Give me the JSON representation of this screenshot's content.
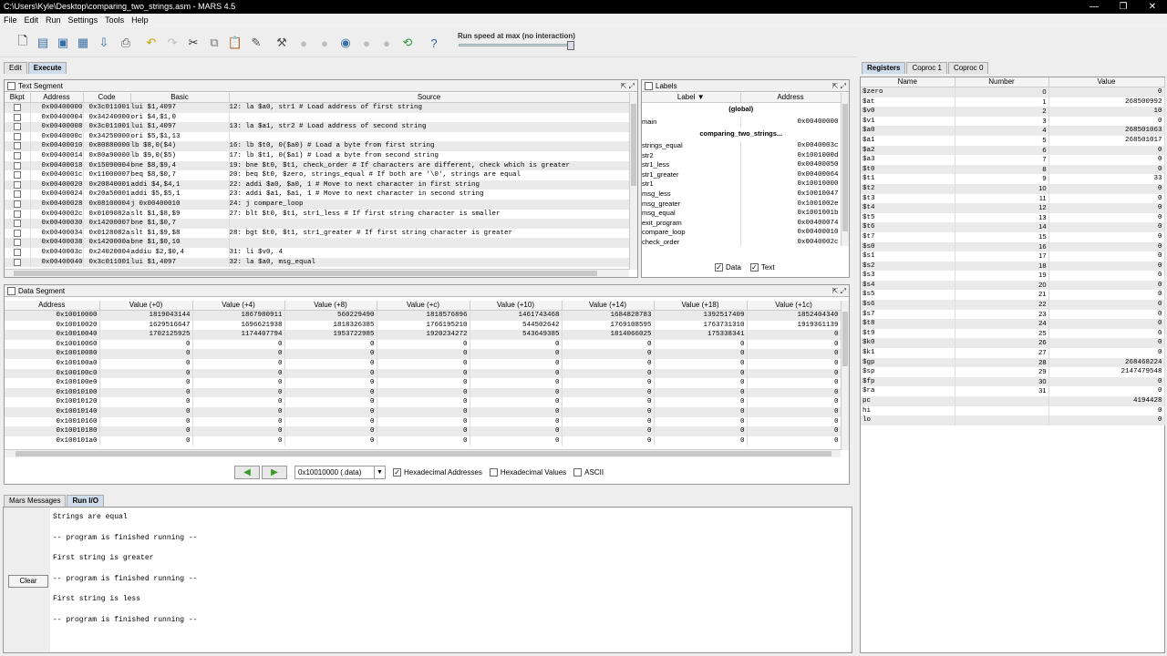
{
  "window": {
    "title": "C:\\Users\\Kyle\\Desktop\\comparing_two_strings.asm - MARS 4.5",
    "controls": [
      "—",
      "❐",
      "✕"
    ]
  },
  "menu": [
    "File",
    "Edit",
    "Run",
    "Settings",
    "Tools",
    "Help"
  ],
  "toolbar": {
    "speed_label": "Run speed at max (no interaction)",
    "speed_level": 1.0,
    "icons": [
      "new-icon",
      "open-icon",
      "save-icon",
      "save-as-icon",
      "dump-icon",
      "print-icon",
      "undo-icon",
      "redo-icon",
      "cut-icon",
      "copy-icon",
      "paste-icon",
      "find-replace-icon",
      "assemble-icon",
      "go-icon",
      "step-icon",
      "backstep-icon",
      "pause-icon",
      "stop-icon",
      "reset-icon",
      "help-icon"
    ]
  },
  "tabs": {
    "edit": "Edit",
    "execute": "Execute"
  },
  "text_segment": {
    "title": "Text Segment",
    "columns": [
      "Bkpt",
      "Address",
      "Code",
      "Basic",
      "Source"
    ],
    "rows": [
      [
        "0x00400000",
        "0x3c011001",
        "lui $1,4097",
        "12:      la $a0, str1    # Load address of first string"
      ],
      [
        "0x00400004",
        "0x34240000",
        "ori $4,$1,0",
        ""
      ],
      [
        "0x00400008",
        "0x3c011001",
        "lui $1,4097",
        "13:      la $a1, str2    # Load address of second string"
      ],
      [
        "0x0040000c",
        "0x34250000",
        "ori $5,$1,13",
        ""
      ],
      [
        "0x00400010",
        "0x80880000",
        "lb $8,0($4)",
        "16:      lb $t0, 0($a0)  # Load a byte from first string"
      ],
      [
        "0x00400014",
        "0x80a90000",
        "lb $9,0($5)",
        "17:      lb $t1, 0($a1)  # Load a byte from second string"
      ],
      [
        "0x00400018",
        "0x15090004",
        "bne $8,$9,4",
        "19:      bne $t0, $t1, check_order  # If characters are different, check which is greater"
      ],
      [
        "0x0040001c",
        "0x11000007",
        "beq $8,$0,7",
        "20:      beq $t0, $zero, strings_equal  # If both are '\\0', strings are equal"
      ],
      [
        "0x00400020",
        "0x20840001",
        "addi $4,$4,1",
        "22:      addi $a0, $a0, 1  # Move to next character in first string"
      ],
      [
        "0x00400024",
        "0x20a50001",
        "addi $5,$5,1",
        "23:      addi $a1, $a1, 1  # Move to next character in second string"
      ],
      [
        "0x00400028",
        "0x08100004",
        "j 0x00400010",
        "24:      j compare_loop"
      ],
      [
        "0x0040002c",
        "0x0109082a",
        "slt $1,$8,$9",
        "27:      blt $t0, $t1, str1_less  # If first string character is smaller"
      ],
      [
        "0x00400030",
        "0x14200007",
        "bne $1,$0,7",
        ""
      ],
      [
        "0x00400034",
        "0x0128082a",
        "slt $1,$9,$8",
        "28:      bgt $t0, $t1, str1_greater # If first string character is greater"
      ],
      [
        "0x00400038",
        "0x1420000a",
        "bne $1,$0,10",
        ""
      ],
      [
        "0x0040003c",
        "0x24020004",
        "addiu $2,$0,4",
        "31:      li $v0, 4"
      ],
      [
        "0x00400040",
        "0x3c011001",
        "lui $1,4097",
        "32:      la $a0, msg_equal"
      ]
    ]
  },
  "labels": {
    "title": "Labels",
    "columns": [
      "Label ▼",
      "Address"
    ],
    "groups": [
      {
        "name": "(global)",
        "items": [
          [
            "main",
            "0x00400000"
          ]
        ]
      },
      {
        "name": "comparing_two_strings...",
        "items": [
          [
            "strings_equal",
            "0x0040003c"
          ],
          [
            "str2",
            "0x1001000d"
          ],
          [
            "str1_less",
            "0x00400050"
          ],
          [
            "str1_greater",
            "0x00400064"
          ],
          [
            "str1",
            "0x10010000"
          ],
          [
            "msg_less",
            "0x10010047"
          ],
          [
            "msg_greater",
            "0x1001002e"
          ],
          [
            "msg_equal",
            "0x1001001b"
          ],
          [
            "exit_program",
            "0x00400074"
          ],
          [
            "compare_loop",
            "0x00400010"
          ],
          [
            "check_order",
            "0x0040002c"
          ]
        ]
      }
    ],
    "data_check": "Data",
    "text_check": "Text"
  },
  "data_segment": {
    "title": "Data Segment",
    "columns": [
      "Address",
      "Value (+0)",
      "Value (+4)",
      "Value (+8)",
      "Value (+c)",
      "Value (+10)",
      "Value (+14)",
      "Value (+18)",
      "Value (+1c)"
    ],
    "rows": [
      [
        "0x10010000",
        "1819043144",
        "1867980911",
        "560229490",
        "1818576896",
        "1461743468",
        "1684828783",
        "1392517409",
        "1852404340"
      ],
      [
        "0x10010020",
        "1629516647",
        "1696621938",
        "1818326385",
        "1766195210",
        "544502642",
        "1769108595",
        "1763731310",
        "1919361139"
      ],
      [
        "0x10010040",
        "1702125925",
        "1174407794",
        "1953722985",
        "1920234272",
        "543649385",
        "1814066025",
        "175338341",
        "0"
      ],
      [
        "0x10010060",
        "0",
        "0",
        "0",
        "0",
        "0",
        "0",
        "0",
        "0"
      ],
      [
        "0x10010080",
        "0",
        "0",
        "0",
        "0",
        "0",
        "0",
        "0",
        "0"
      ],
      [
        "0x100100a0",
        "0",
        "0",
        "0",
        "0",
        "0",
        "0",
        "0",
        "0"
      ],
      [
        "0x100100c0",
        "0",
        "0",
        "0",
        "0",
        "0",
        "0",
        "0",
        "0"
      ],
      [
        "0x100100e0",
        "0",
        "0",
        "0",
        "0",
        "0",
        "0",
        "0",
        "0"
      ],
      [
        "0x10010100",
        "0",
        "0",
        "0",
        "0",
        "0",
        "0",
        "0",
        "0"
      ],
      [
        "0x10010120",
        "0",
        "0",
        "0",
        "0",
        "0",
        "0",
        "0",
        "0"
      ],
      [
        "0x10010140",
        "0",
        "0",
        "0",
        "0",
        "0",
        "0",
        "0",
        "0"
      ],
      [
        "0x10010160",
        "0",
        "0",
        "0",
        "0",
        "0",
        "0",
        "0",
        "0"
      ],
      [
        "0x10010180",
        "0",
        "0",
        "0",
        "0",
        "0",
        "0",
        "0",
        "0"
      ],
      [
        "0x100101a0",
        "0",
        "0",
        "0",
        "0",
        "0",
        "0",
        "0",
        "0"
      ]
    ],
    "segment_select": "0x10010000 (.data)",
    "hex_addresses": "Hexadecimal Addresses",
    "hex_values": "Hexadecimal Values",
    "ascii": "ASCII"
  },
  "messages": {
    "tab_mars": "Mars Messages",
    "tab_run": "Run I/O",
    "clear": "Clear",
    "output": [
      "Strings are equal",
      "",
      "-- program is finished running --",
      "",
      "First string is greater",
      "",
      "-- program is finished running --",
      "",
      "First string is less",
      "",
      "-- program is finished running --"
    ]
  },
  "registers": {
    "tabs": [
      "Registers",
      "Coproc 1",
      "Coproc 0"
    ],
    "columns": [
      "Name",
      "Number",
      "Value"
    ],
    "rows": [
      [
        "$zero",
        "0",
        "0"
      ],
      [
        "$at",
        "1",
        "268500992"
      ],
      [
        "$v0",
        "2",
        "10"
      ],
      [
        "$v1",
        "3",
        "0"
      ],
      [
        "$a0",
        "4",
        "268501063"
      ],
      [
        "$a1",
        "5",
        "268501017"
      ],
      [
        "$a2",
        "6",
        "0"
      ],
      [
        "$a3",
        "7",
        "0"
      ],
      [
        "$t0",
        "8",
        "0"
      ],
      [
        "$t1",
        "9",
        "33"
      ],
      [
        "$t2",
        "10",
        "0"
      ],
      [
        "$t3",
        "11",
        "0"
      ],
      [
        "$t4",
        "12",
        "0"
      ],
      [
        "$t5",
        "13",
        "0"
      ],
      [
        "$t6",
        "14",
        "0"
      ],
      [
        "$t7",
        "15",
        "0"
      ],
      [
        "$s0",
        "16",
        "0"
      ],
      [
        "$s1",
        "17",
        "0"
      ],
      [
        "$s2",
        "18",
        "0"
      ],
      [
        "$s3",
        "19",
        "0"
      ],
      [
        "$s4",
        "20",
        "0"
      ],
      [
        "$s5",
        "21",
        "0"
      ],
      [
        "$s6",
        "22",
        "0"
      ],
      [
        "$s7",
        "23",
        "0"
      ],
      [
        "$t8",
        "24",
        "0"
      ],
      [
        "$t9",
        "25",
        "0"
      ],
      [
        "$k0",
        "26",
        "0"
      ],
      [
        "$k1",
        "27",
        "0"
      ],
      [
        "$gp",
        "28",
        "268468224"
      ],
      [
        "$sp",
        "29",
        "2147479548"
      ],
      [
        "$fp",
        "30",
        "0"
      ],
      [
        "$ra",
        "31",
        "0"
      ],
      [
        "pc",
        "",
        "4194428"
      ],
      [
        "hi",
        "",
        "0"
      ],
      [
        "lo",
        "",
        "0"
      ]
    ]
  }
}
